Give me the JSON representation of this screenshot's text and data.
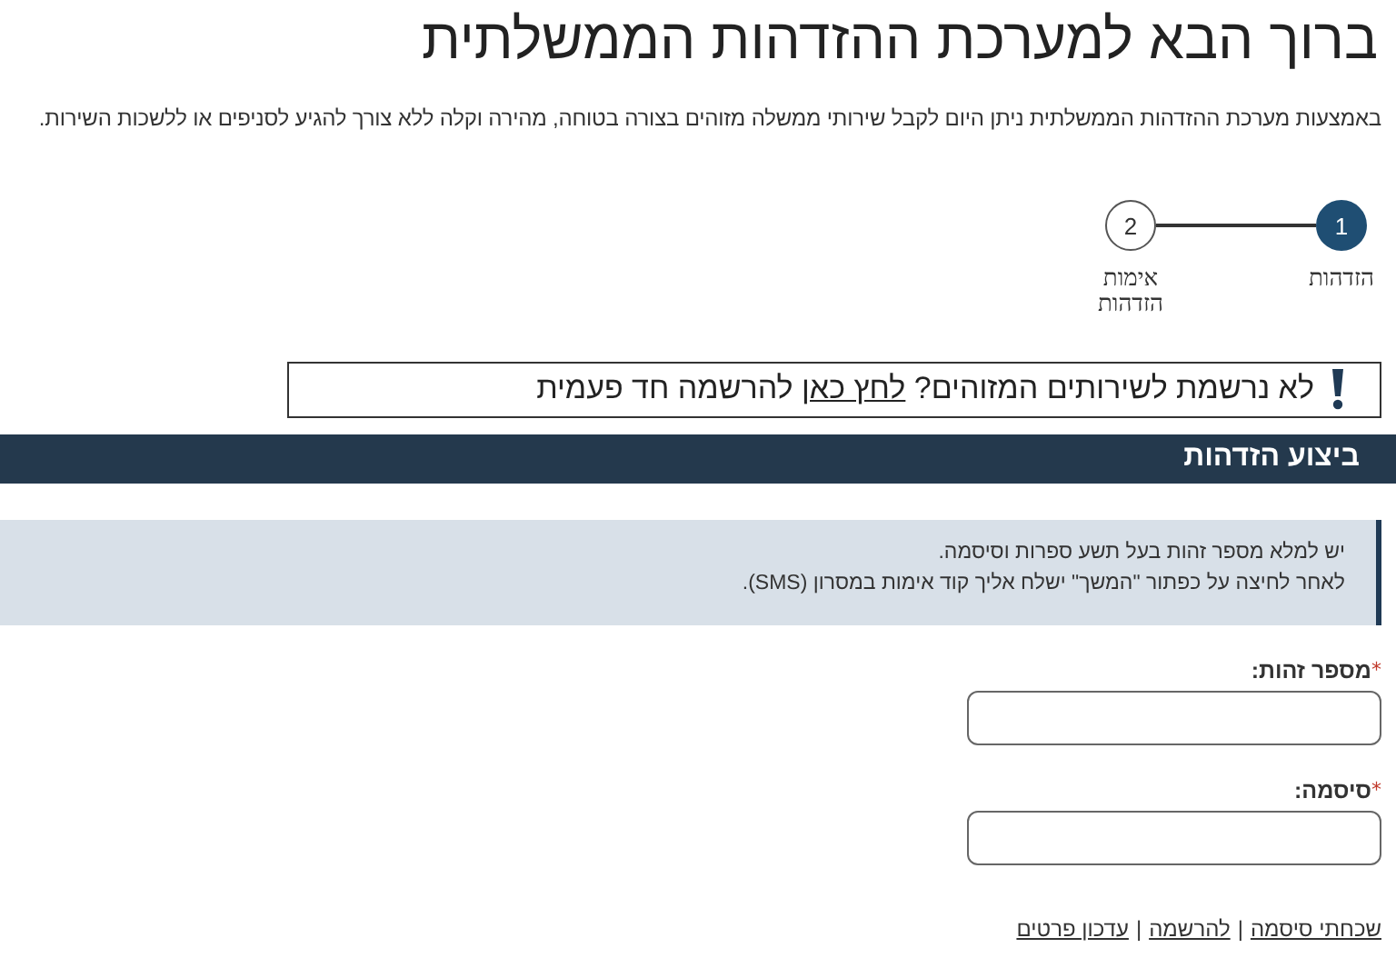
{
  "title": "ברוך הבא למערכת ההזדהות הממשלתית",
  "intro": "באמצעות מערכת ההזדהות הממשלתית ניתן היום לקבל שירותי ממשלה מזוהים בצורה בטוחה, מהירה וקלה ללא צורך להגיע לסניפים או ללשכות השירות.",
  "steps": [
    {
      "number": "1",
      "label": "הזדהות",
      "selected": true
    },
    {
      "number": "2",
      "label": "אימות הזדהות",
      "selected": false
    }
  ],
  "notice": {
    "before": "לא נרשמת לשירותים המזוהים?",
    "link": "לחץ כאן",
    "after": "להרשמה חד פעמית"
  },
  "section_title": "ביצוע הזדהות",
  "info_lines": [
    "יש למלא מספר זהות בעל תשע ספרות וסיסמה.",
    "לאחר לחיצה על כפתור \"המשך\" ישלח אליך קוד אימות במסרון (SMS)."
  ],
  "fields": [
    {
      "label": "מספר זהות:",
      "required_mark": "*"
    },
    {
      "label": "סיסמה:",
      "required_mark": "*"
    }
  ],
  "footer": {
    "separator": "|",
    "links": [
      "שכחתי סיסמה",
      "להרשמה",
      "עדכון פרטים"
    ]
  }
}
